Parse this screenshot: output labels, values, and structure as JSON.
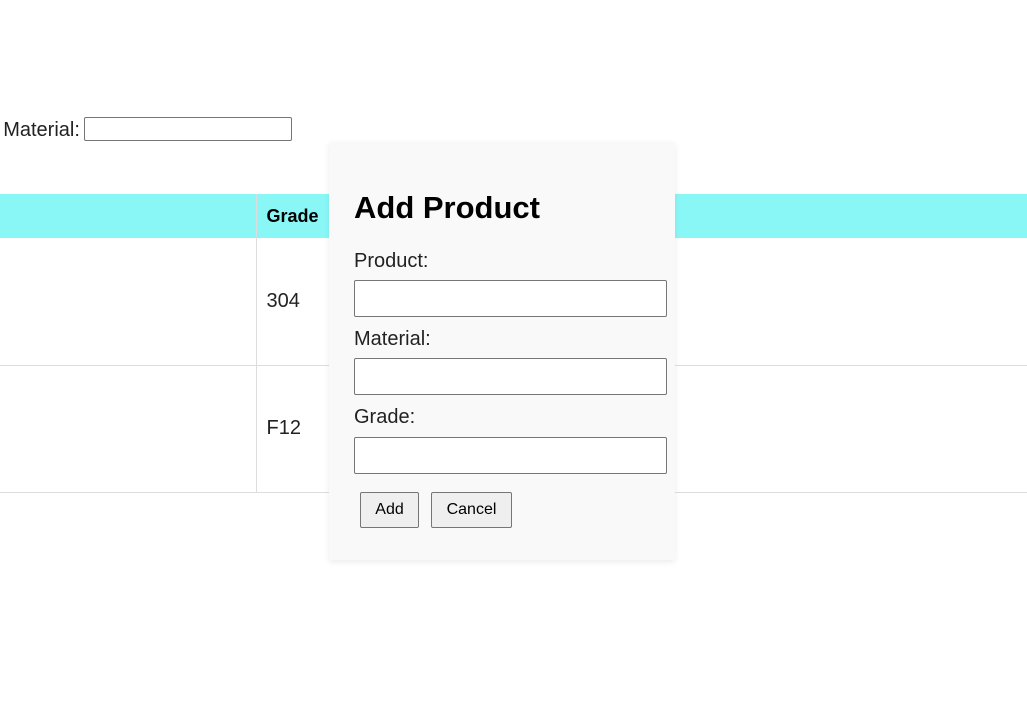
{
  "filter": {
    "label": "r Material:",
    "value": ""
  },
  "table": {
    "headers": [
      "",
      "Grade"
    ],
    "rows": [
      {
        "col1": "",
        "grade": "304"
      },
      {
        "col1": "",
        "grade": "F12"
      }
    ]
  },
  "modal": {
    "title": "Add Product",
    "product_label": "Product:",
    "product_value": "",
    "material_label": "Material:",
    "material_value": "",
    "grade_label": "Grade:",
    "grade_value": "",
    "add_label": "Add",
    "cancel_label": "Cancel"
  },
  "colors": {
    "header_bg": "#8af7f7",
    "modal_bg": "#f9f9f9"
  }
}
